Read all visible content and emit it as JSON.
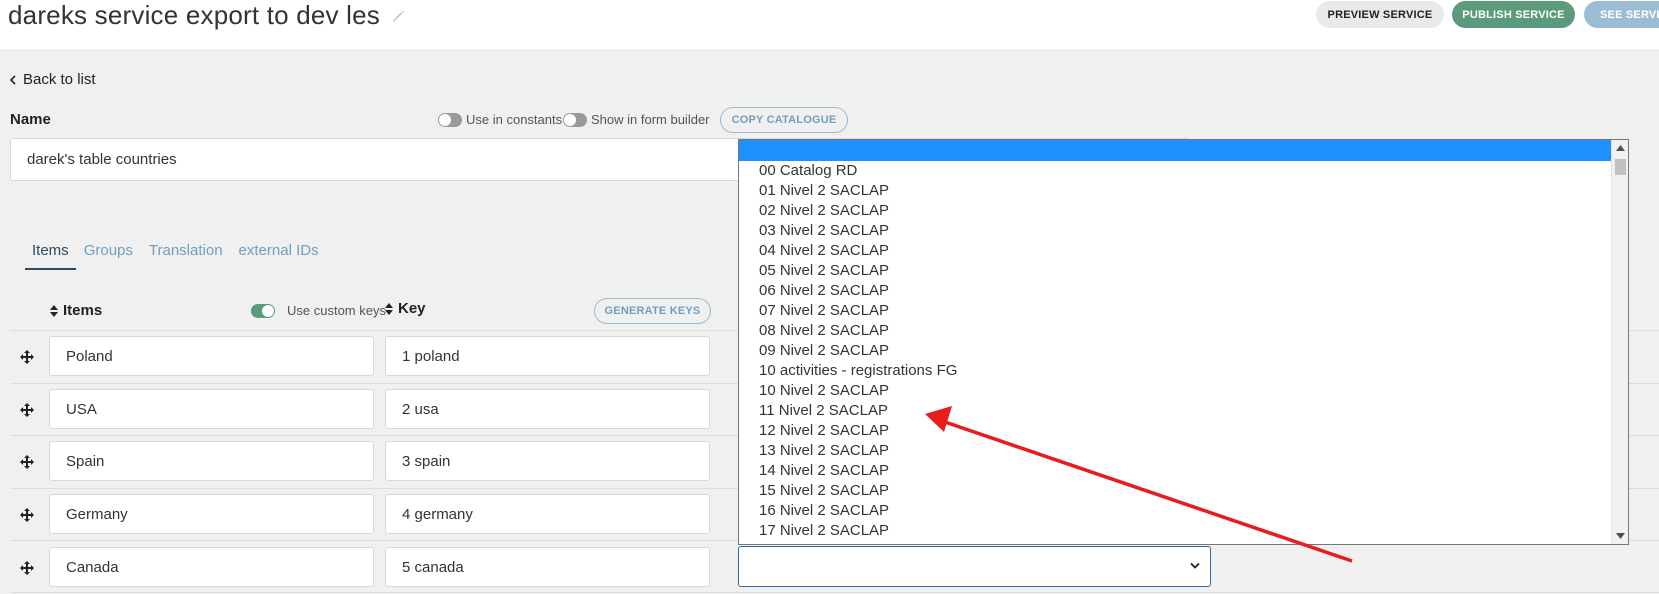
{
  "header": {
    "title": "dareks service export to dev les",
    "edit_icon": "pencil-icon",
    "buttons": {
      "preview": "PREVIEW SERVICE",
      "publish": "PUBLISH SERVICE",
      "see": "SEE SERVICE"
    }
  },
  "nav": {
    "back_label": "Back to list"
  },
  "name_section": {
    "label": "Name",
    "toggle_constants": "Use in constants",
    "toggle_form_builder": "Show in form builder",
    "copy_catalogue": "COPY CATALOGUE",
    "value": "darek's table countries"
  },
  "tabs": [
    "Items",
    "Groups",
    "Translation",
    "external IDs"
  ],
  "table": {
    "items_header": "Items",
    "use_custom_keys": "Use custom keys",
    "key_header": "Key",
    "generate_keys": "GENERATE KEYS",
    "rows": [
      {
        "item": "Poland",
        "key": "1 poland"
      },
      {
        "item": "USA",
        "key": "2 usa"
      },
      {
        "item": "Spain",
        "key": "3 spain"
      },
      {
        "item": "Germany",
        "key": "4 germany"
      },
      {
        "item": "Canada",
        "key": "5 canada"
      }
    ]
  },
  "dropdown": {
    "selected_value": "",
    "options": [
      "00 Catalog RD",
      "01 Nivel 2 SACLAP",
      "02 Nivel 2 SACLAP",
      "03 Nivel 2 SACLAP",
      "04 Nivel 2 SACLAP",
      "05 Nivel 2 SACLAP",
      "06 Nivel 2 SACLAP",
      "07 Nivel 2 SACLAP",
      "08 Nivel 2 SACLAP",
      "09 Nivel 2 SACLAP",
      "10 activities - registrations FG",
      "10 Nivel 2 SACLAP",
      "11 Nivel 2 SACLAP",
      "12 Nivel 2 SACLAP",
      "13 Nivel 2 SACLAP",
      "14 Nivel 2 SACLAP",
      "15 Nivel 2 SACLAP",
      "16 Nivel 2 SACLAP",
      "17 Nivel 2 SACLAP"
    ]
  },
  "colors": {
    "publish": "#5b9a7a",
    "see": "#9bbdd3",
    "highlight": "#1e90ff",
    "annotation_arrow": "#e81c1c"
  }
}
